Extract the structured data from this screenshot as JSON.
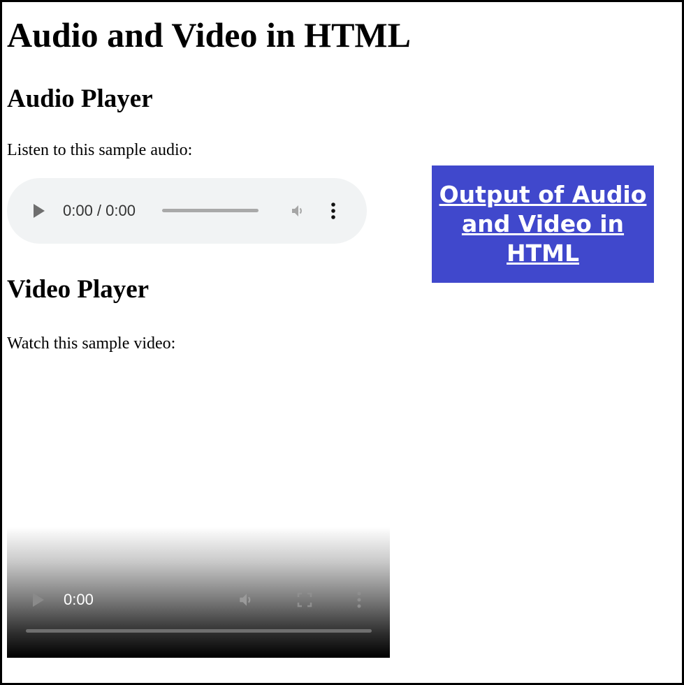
{
  "page": {
    "title": "Audio and Video in HTML"
  },
  "audio_section": {
    "heading": "Audio Player",
    "description": "Listen to this sample audio:",
    "player": {
      "time_display": "0:00 / 0:00",
      "progress": 0,
      "icons": [
        "play-icon",
        "volume-icon",
        "more-options-icon"
      ]
    }
  },
  "video_section": {
    "heading": "Video Player",
    "description": "Watch this sample video:",
    "player": {
      "time_display": "0:00",
      "progress": 0,
      "icons": [
        "play-icon",
        "volume-icon",
        "fullscreen-icon",
        "more-options-icon"
      ]
    }
  },
  "banner": {
    "text": "Output of Audio and Video in HTML",
    "background": "#4048cc",
    "text_color": "#ffffff"
  }
}
